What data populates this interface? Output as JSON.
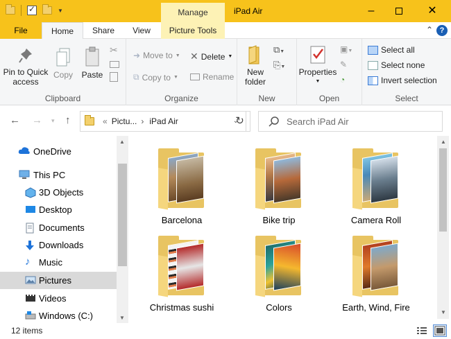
{
  "window": {
    "title": "iPad Air",
    "context_tab": "Manage",
    "accent": "#f7c21b"
  },
  "tabs": {
    "file": "File",
    "home": "Home",
    "share": "Share",
    "view": "View",
    "picture_tools": "Picture Tools",
    "help": "?"
  },
  "ribbon": {
    "clipboard": {
      "label": "Clipboard",
      "pin": "Pin to Quick access",
      "copy": "Copy",
      "paste": "Paste"
    },
    "organize": {
      "label": "Organize",
      "move_to": "Move to",
      "copy_to": "Copy to",
      "delete": "Delete",
      "rename": "Rename"
    },
    "new": {
      "label": "New",
      "new_folder": "New folder"
    },
    "open": {
      "label": "Open",
      "properties": "Properties"
    },
    "select": {
      "label": "Select",
      "select_all": "Select all",
      "select_none": "Select none",
      "invert": "Invert selection"
    }
  },
  "address": {
    "prefix": "«",
    "crumb1": "Pictu...",
    "crumb2": "iPad Air",
    "search_placeholder": "Search iPad Air"
  },
  "nav_pane": {
    "items": [
      {
        "label": "OneDrive",
        "icon": "cloud-icon"
      },
      {
        "label": "This PC",
        "icon": "computer-icon"
      },
      {
        "label": "3D Objects",
        "icon": "cube-icon"
      },
      {
        "label": "Desktop",
        "icon": "desktop-icon"
      },
      {
        "label": "Documents",
        "icon": "document-icon"
      },
      {
        "label": "Downloads",
        "icon": "download-icon"
      },
      {
        "label": "Music",
        "icon": "music-icon"
      },
      {
        "label": "Pictures",
        "icon": "pictures-icon"
      },
      {
        "label": "Videos",
        "icon": "video-icon"
      },
      {
        "label": "Windows (C:)",
        "icon": "drive-icon"
      }
    ],
    "selected": "Pictures"
  },
  "folders": [
    {
      "name": "Barcelona"
    },
    {
      "name": "Bike trip"
    },
    {
      "name": "Camera Roll"
    },
    {
      "name": "Christmas sushi"
    },
    {
      "name": "Colors"
    },
    {
      "name": "Earth, Wind, Fire"
    }
  ],
  "status": {
    "count": "12 items"
  }
}
